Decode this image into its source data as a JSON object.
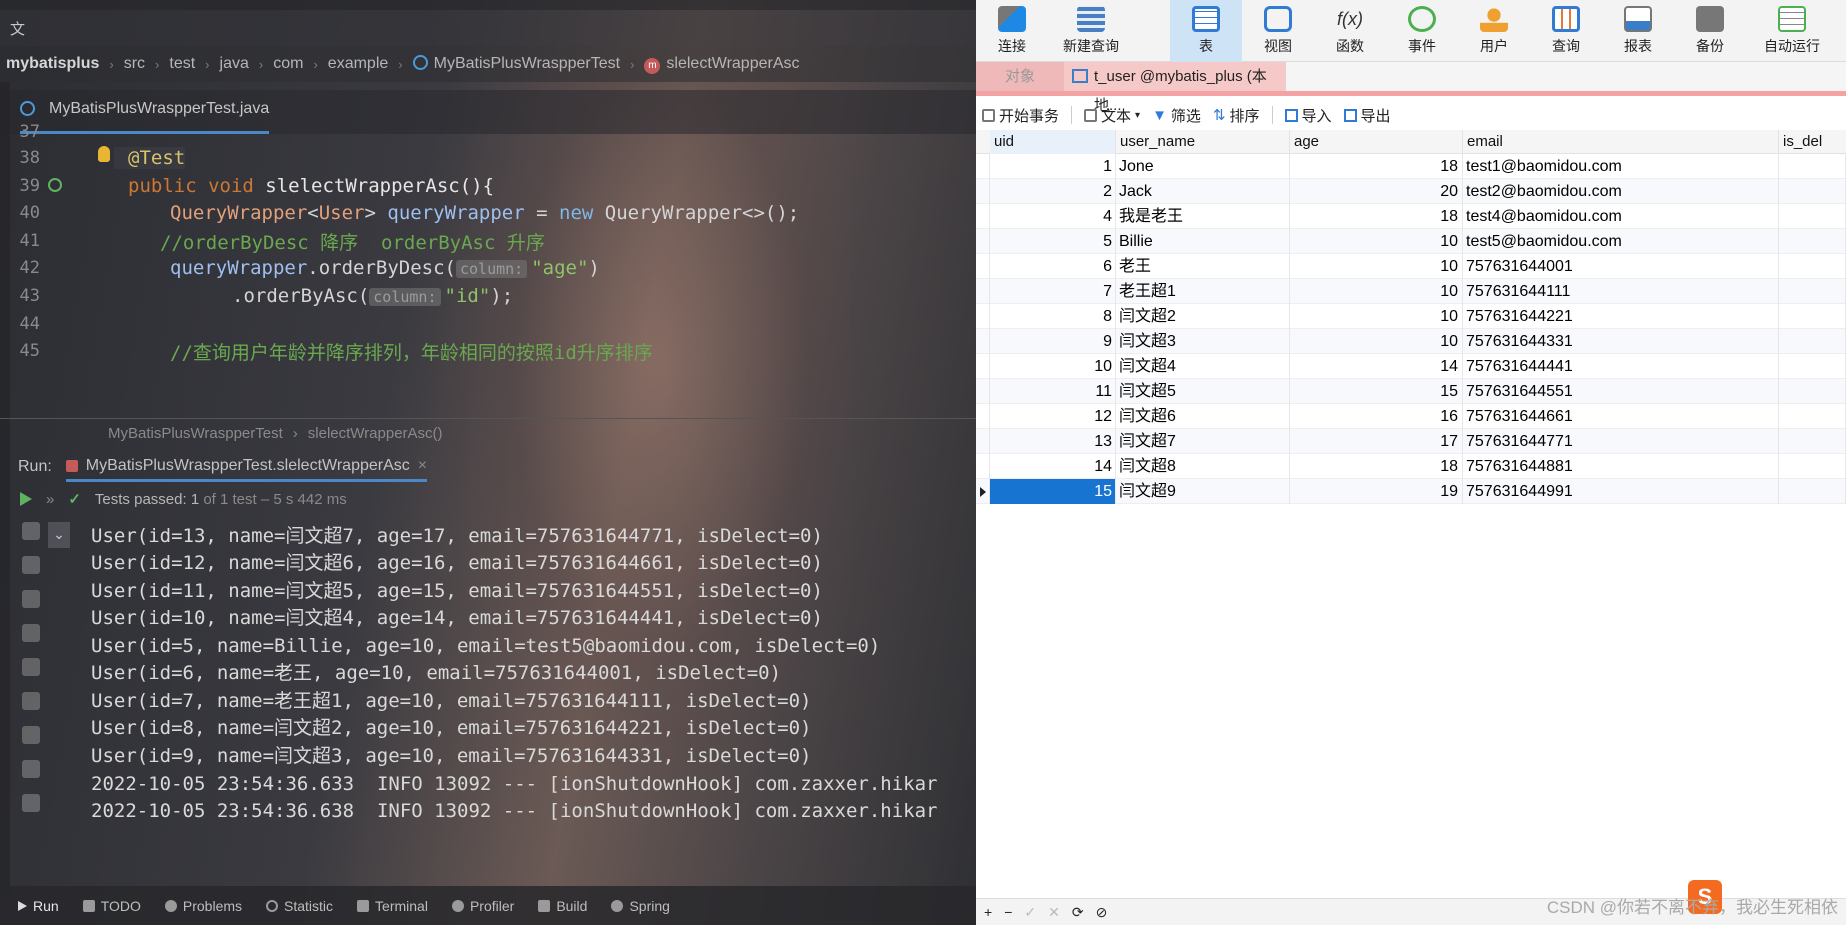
{
  "ide": {
    "menubar": [
      "文"
    ],
    "breadcrumb": {
      "project": "mybatisplus",
      "parts": [
        "src",
        "test",
        "java",
        "com",
        "example"
      ],
      "class": "MyBatisPlusWraspperTest",
      "method": "slelectWrapperAsc"
    },
    "file_tab": "MyBatisPlusWraspperTest.java",
    "editor": {
      "lines": [
        {
          "no": "37",
          "text": ""
        },
        {
          "no": "38",
          "text": "@Test"
        },
        {
          "no": "39",
          "text": "public void slelectWrapperAsc(){"
        },
        {
          "no": "40",
          "text": "QueryWrapper<User> queryWrapper = new QueryWrapper<>();"
        },
        {
          "no": "41",
          "text": "//orderByDesc 降序  orderByAsc 升序"
        },
        {
          "no": "42",
          "text": "queryWrapper.orderByDesc(\"age\")"
        },
        {
          "no": "43",
          "text": ".orderByAsc(\"id\");"
        },
        {
          "no": "44",
          "text": ""
        },
        {
          "no": "45",
          "text": "//查询用户年龄并降序排列，年龄相同的按照id升序排序"
        }
      ],
      "param_hint": "column:",
      "crumb": [
        "MyBatisPlusWraspperTest",
        "slelectWrapperAsc()"
      ]
    },
    "run": {
      "label": "Run:",
      "tab": "MyBatisPlusWraspperTest.slelectWrapperAsc",
      "status_prefix": "Tests passed:",
      "status_count": "1",
      "status_of": "of 1 test",
      "status_time": "– 5 s 442 ms"
    },
    "console": [
      "User(id=13, name=闫文超7, age=17, email=757631644771, isDelect=0)",
      "User(id=12, name=闫文超6, age=16, email=757631644661, isDelect=0)",
      "User(id=11, name=闫文超5, age=15, email=757631644551, isDelect=0)",
      "User(id=10, name=闫文超4, age=14, email=757631644441, isDelect=0)",
      "User(id=5, name=Billie, age=10, email=test5@baomidou.com, isDelect=0)",
      "User(id=6, name=老王, age=10, email=757631644001, isDelect=0)",
      "User(id=7, name=老王超1, age=10, email=757631644111, isDelect=0)",
      "User(id=8, name=闫文超2, age=10, email=757631644221, isDelect=0)",
      "User(id=9, name=闫文超3, age=10, email=757631644331, isDelect=0)",
      "2022-10-05 23:54:36.633  INFO 13092 --- [ionShutdownHook] com.zaxxer.hikar",
      "2022-10-05 23:54:36.638  INFO 13092 --- [ionShutdownHook] com.zaxxer.hikar"
    ],
    "bottom_tools": [
      "Run",
      "TODO",
      "Problems",
      "Statistic",
      "Terminal",
      "Profiler",
      "Build",
      "Spring"
    ]
  },
  "navicat": {
    "toolbar": [
      "连接",
      "新建查询",
      "表",
      "视图",
      "函数",
      "事件",
      "用户",
      "查询",
      "报表",
      "备份",
      "自动运行"
    ],
    "tabs": {
      "objects": "对象",
      "table": "t_user @mybatis_plus (本地..."
    },
    "actions": [
      "开始事务",
      "文本",
      "筛选",
      "排序",
      "导入",
      "导出"
    ],
    "columns": [
      "uid",
      "user_name",
      "age",
      "email",
      "is_del"
    ],
    "rows": [
      {
        "uid": "1",
        "user_name": "Jone",
        "age": "18",
        "email": "test1@baomidou.com"
      },
      {
        "uid": "2",
        "user_name": "Jack",
        "age": "20",
        "email": "test2@baomidou.com"
      },
      {
        "uid": "4",
        "user_name": "我是老王",
        "age": "18",
        "email": "test4@baomidou.com"
      },
      {
        "uid": "5",
        "user_name": "Billie",
        "age": "10",
        "email": "test5@baomidou.com"
      },
      {
        "uid": "6",
        "user_name": "老王",
        "age": "10",
        "email": "757631644001"
      },
      {
        "uid": "7",
        "user_name": "老王超1",
        "age": "10",
        "email": "757631644111"
      },
      {
        "uid": "8",
        "user_name": "闫文超2",
        "age": "10",
        "email": "757631644221"
      },
      {
        "uid": "9",
        "user_name": "闫文超3",
        "age": "10",
        "email": "757631644331"
      },
      {
        "uid": "10",
        "user_name": "闫文超4",
        "age": "14",
        "email": "757631644441"
      },
      {
        "uid": "11",
        "user_name": "闫文超5",
        "age": "15",
        "email": "757631644551"
      },
      {
        "uid": "12",
        "user_name": "闫文超6",
        "age": "16",
        "email": "757631644661"
      },
      {
        "uid": "13",
        "user_name": "闫文超7",
        "age": "17",
        "email": "757631644771"
      },
      {
        "uid": "14",
        "user_name": "闫文超8",
        "age": "18",
        "email": "757631644881"
      },
      {
        "uid": "15",
        "user_name": "闫文超9",
        "age": "19",
        "email": "757631644991"
      }
    ],
    "footer_buttons": [
      "+",
      "−",
      "✓",
      "✕",
      "⟳",
      "⊘"
    ],
    "watermark": "CSDN @你若不离不弃，我必生死相依"
  },
  "colors": {
    "selection": "#1874d1",
    "accent_tab": "#f3a3a3",
    "run_green": "#5fb35f"
  }
}
